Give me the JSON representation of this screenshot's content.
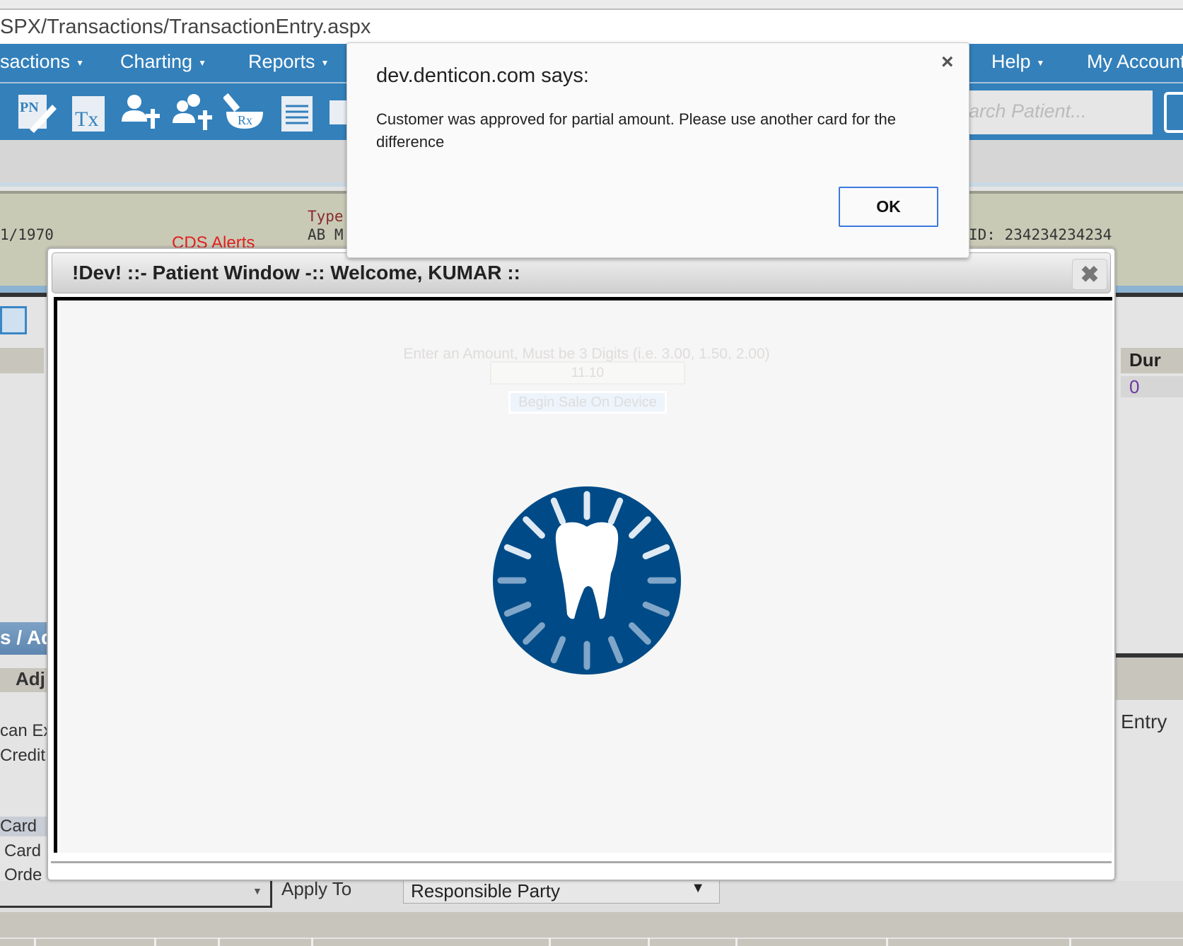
{
  "browser": {
    "address": "SPX/Transactions/TransactionEntry.aspx"
  },
  "nav": {
    "items": [
      {
        "label": "sactions",
        "caret": "▼"
      },
      {
        "label": "Charting",
        "caret": "▼"
      },
      {
        "label": "Reports",
        "caret": "▼"
      },
      {
        "label": "Help",
        "caret": "▼"
      },
      {
        "label": "My Account"
      }
    ]
  },
  "toolbar": {
    "icons": [
      "progress-notes-icon",
      "treatment-icon",
      "add-patient-icon",
      "add-family-member-icon",
      "prescription-icon",
      "notes-icon",
      "mail-icon"
    ],
    "search_placeholder": "arch Patient..."
  },
  "patient_band": {
    "dob": "1/1970",
    "cds_alerts": "CDS Alerts",
    "type_label": "Type",
    "type_value": "AB M",
    "id": "ID: 234234234234"
  },
  "background": {
    "left_header": "s / Ad",
    "adj_label": "Adj",
    "items": [
      "can Ex",
      "Credit",
      "Card",
      "Card",
      "Orde"
    ],
    "dur_header": "Dur",
    "dur_value": "0",
    "entry": "Entry",
    "apply_to": "Apply To",
    "apply_to_value": "Responsible Party"
  },
  "patient_window": {
    "title": "!Dev! ::- Patient Window -:: Welcome, KUMAR ::",
    "close": "✖",
    "amount_label": "Enter an Amount, Must be 3 Digits (i.e. 3.00, 1.50, 2.00)",
    "amount_value": "11.10",
    "begin_button": "Begin Sale On Device",
    "logo_color": "#004b87"
  },
  "alert": {
    "title": "dev.denticon.com says:",
    "message": "Customer was approved for partial amount. Please use another card for the difference",
    "ok": "OK",
    "close": "×"
  },
  "colors": {
    "nav": "#3380bb",
    "cds_alerts": "#e02020",
    "ok_border": "#3c78e0"
  }
}
